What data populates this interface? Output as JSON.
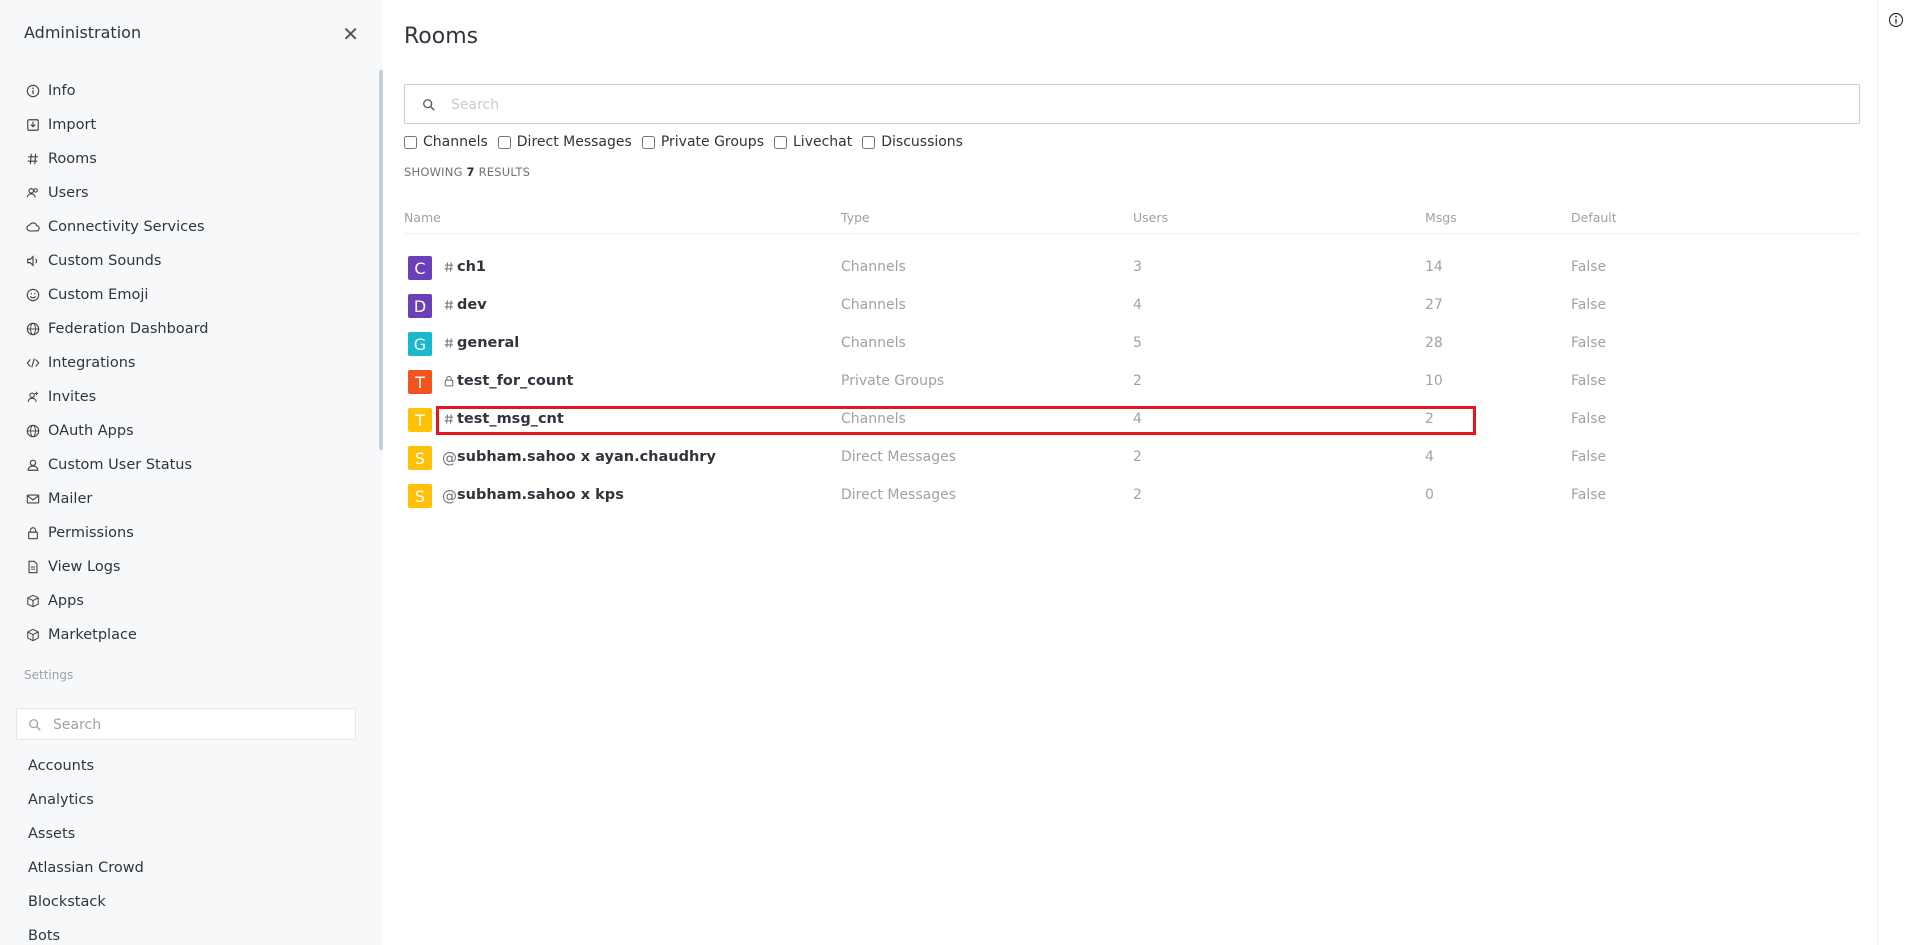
{
  "sidebar": {
    "title": "Administration",
    "close_icon": "close-icon",
    "items": [
      {
        "label": "Info",
        "icon": "info-icon"
      },
      {
        "label": "Import",
        "icon": "import-icon"
      },
      {
        "label": "Rooms",
        "icon": "hash-icon"
      },
      {
        "label": "Users",
        "icon": "users-icon"
      },
      {
        "label": "Connectivity Services",
        "icon": "cloud-icon"
      },
      {
        "label": "Custom Sounds",
        "icon": "sound-icon"
      },
      {
        "label": "Custom Emoji",
        "icon": "emoji-icon"
      },
      {
        "label": "Federation Dashboard",
        "icon": "globe-icon"
      },
      {
        "label": "Integrations",
        "icon": "code-icon"
      },
      {
        "label": "Invites",
        "icon": "invite-icon"
      },
      {
        "label": "OAuth Apps",
        "icon": "globe-icon"
      },
      {
        "label": "Custom User Status",
        "icon": "user-icon"
      },
      {
        "label": "Mailer",
        "icon": "mail-icon"
      },
      {
        "label": "Permissions",
        "icon": "lock-icon"
      },
      {
        "label": "View Logs",
        "icon": "file-icon"
      },
      {
        "label": "Apps",
        "icon": "cube-icon"
      },
      {
        "label": "Marketplace",
        "icon": "cube-icon"
      }
    ],
    "settings_label": "Settings",
    "settings_search_placeholder": "Search",
    "settings_items": [
      "Accounts",
      "Analytics",
      "Assets",
      "Atlassian Crowd",
      "Blockstack",
      "Bots"
    ]
  },
  "main": {
    "title": "Rooms",
    "search_placeholder": "Search",
    "filters": [
      "Channels",
      "Direct Messages",
      "Private Groups",
      "Livechat",
      "Discussions"
    ],
    "results_prefix": "SHOWING",
    "results_count": "7",
    "results_suffix": "RESULTS",
    "columns": {
      "name": "Name",
      "type": "Type",
      "users": "Users",
      "msgs": "Msgs",
      "default": "Default"
    },
    "rows": [
      {
        "avatar": "C",
        "avatar_color": "#6b3fb8",
        "icon": "#",
        "name": "ch1",
        "type": "Channels",
        "users": "3",
        "msgs": "14",
        "default": "False"
      },
      {
        "avatar": "D",
        "avatar_color": "#6b3fb8",
        "icon": "#",
        "name": "dev",
        "type": "Channels",
        "users": "4",
        "msgs": "27",
        "default": "False"
      },
      {
        "avatar": "G",
        "avatar_color": "#19b8cc",
        "icon": "#",
        "name": "general",
        "type": "Channels",
        "users": "5",
        "msgs": "28",
        "default": "False"
      },
      {
        "avatar": "T",
        "avatar_color": "#f2531f",
        "icon": "lock",
        "name": "test_for_count",
        "type": "Private Groups",
        "users": "2",
        "msgs": "10",
        "default": "False"
      },
      {
        "avatar": "T",
        "avatar_color": "#ffc107",
        "icon": "#",
        "name": "test_msg_cnt",
        "type": "Channels",
        "users": "4",
        "msgs": "2",
        "default": "False"
      },
      {
        "avatar": "S",
        "avatar_color": "#ffc107",
        "icon": "@",
        "name": "subham.sahoo x ayan.chaudhry",
        "type": "Direct Messages",
        "users": "2",
        "msgs": "4",
        "default": "False"
      },
      {
        "avatar": "S",
        "avatar_color": "#ffc107",
        "icon": "@",
        "name": "subham.sahoo x kps",
        "type": "Direct Messages",
        "users": "2",
        "msgs": "0",
        "default": "False"
      }
    ],
    "highlight_color": "#e3161f"
  }
}
